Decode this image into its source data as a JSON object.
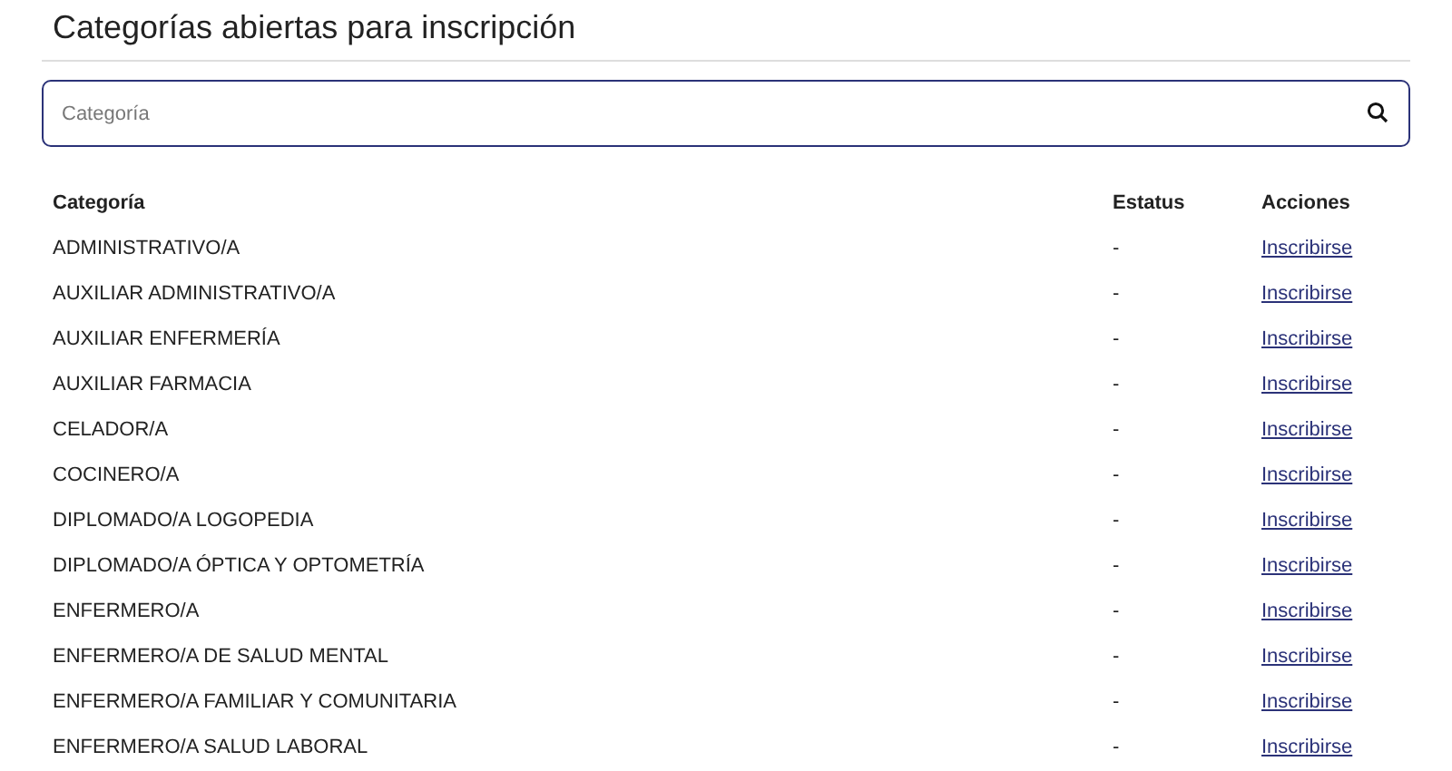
{
  "title": "Categorías abiertas para inscripción",
  "search": {
    "placeholder": "Categoría"
  },
  "table": {
    "columns": [
      "Categoría",
      "Estatus",
      "Acciones"
    ],
    "rows": [
      {
        "category": "ADMINISTRATIVO/A",
        "status": "-",
        "action": "Inscribirse"
      },
      {
        "category": "AUXILIAR ADMINISTRATIVO/A",
        "status": "-",
        "action": "Inscribirse"
      },
      {
        "category": "AUXILIAR ENFERMERÍA",
        "status": "-",
        "action": "Inscribirse"
      },
      {
        "category": "AUXILIAR FARMACIA",
        "status": "-",
        "action": "Inscribirse"
      },
      {
        "category": "CELADOR/A",
        "status": "-",
        "action": "Inscribirse"
      },
      {
        "category": "COCINERO/A",
        "status": "-",
        "action": "Inscribirse"
      },
      {
        "category": "DIPLOMADO/A LOGOPEDIA",
        "status": "-",
        "action": "Inscribirse"
      },
      {
        "category": "DIPLOMADO/A ÓPTICA Y OPTOMETRÍA",
        "status": "-",
        "action": "Inscribirse"
      },
      {
        "category": "ENFERMERO/A",
        "status": "-",
        "action": "Inscribirse"
      },
      {
        "category": "ENFERMERO/A DE SALUD MENTAL",
        "status": "-",
        "action": "Inscribirse"
      },
      {
        "category": "ENFERMERO/A FAMILIAR Y COMUNITARIA",
        "status": "-",
        "action": "Inscribirse"
      },
      {
        "category": "ENFERMERO/A SALUD LABORAL",
        "status": "-",
        "action": "Inscribirse"
      }
    ]
  }
}
